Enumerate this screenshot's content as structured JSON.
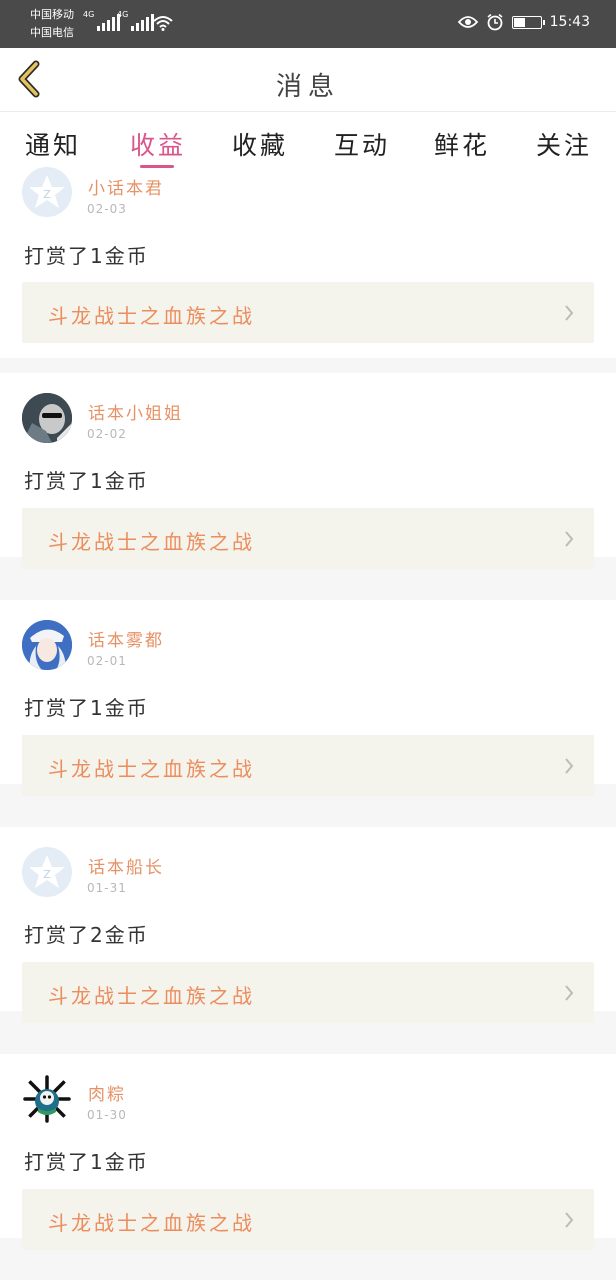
{
  "status_bar": {
    "carrier_1": "中国移动",
    "carrier_2": "中国电信",
    "net_1": "4G",
    "net_2": "4G",
    "battery": "41",
    "time": "15:43"
  },
  "header": {
    "title": "消息"
  },
  "tabs": [
    {
      "label": "通知"
    },
    {
      "label": "收益",
      "active": true
    },
    {
      "label": "收藏"
    },
    {
      "label": "互动"
    },
    {
      "label": "鲜花"
    },
    {
      "label": "关注"
    }
  ],
  "messages": [
    {
      "user": "小话本君",
      "date": "02-03",
      "text": "打赏了1金币",
      "book": "斗龙战士之血族之战",
      "avatar": "default-qq-avatar"
    },
    {
      "user": "话本小姐姐",
      "date": "02-02",
      "text": "打赏了1金币",
      "book": "斗龙战士之血族之战",
      "avatar": "photo-avatar"
    },
    {
      "user": "话本雾都",
      "date": "02-01",
      "text": "打赏了1金币",
      "book": "斗龙战士之血族之战",
      "avatar": "anime-avatar"
    },
    {
      "user": "话本船长",
      "date": "01-31",
      "text": "打赏了2金币",
      "book": "斗龙战士之血族之战",
      "avatar": "default-qq-avatar"
    },
    {
      "user": "肉粽",
      "date": "01-30",
      "text": "打赏了1金币",
      "book": "斗龙战士之血族之战",
      "avatar": "skull-avatar"
    }
  ],
  "colors": {
    "accent": "#d9558a",
    "username": "#e79266",
    "book_link": "#ec8d5e",
    "back_arrow": "#c9a640"
  }
}
